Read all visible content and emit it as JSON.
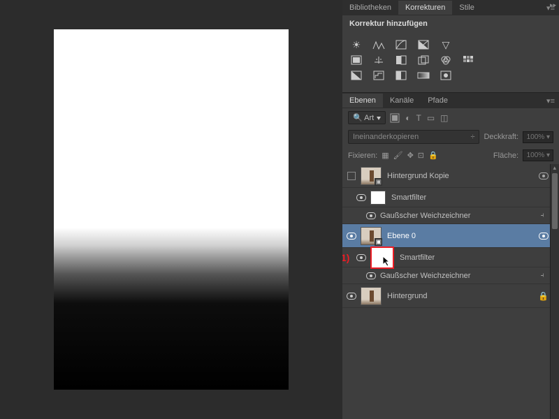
{
  "top_tabs": {
    "bibliotheken": "Bibliotheken",
    "korrekturen": "Korrekturen",
    "stile": "Stile"
  },
  "corrections": {
    "add_label": "Korrektur hinzufügen"
  },
  "layers_tabs": {
    "ebenen": "Ebenen",
    "kanaele": "Kanäle",
    "pfade": "Pfade"
  },
  "filter_kind": "Art",
  "blend_mode": "Ineinanderkopieren",
  "opacity_label": "Deckkraft:",
  "opacity_value": "100%",
  "lock_label": "Fixieren:",
  "fill_label": "Fläche:",
  "fill_value": "100%",
  "layers": {
    "bg_copy": "Hintergrund Kopie",
    "smartfilter": "Smartfilter",
    "gauss": "Gaußscher Weichzeichner",
    "ebene0": "Ebene 0",
    "hintergrund": "Hintergrund"
  },
  "annotation": "1)"
}
